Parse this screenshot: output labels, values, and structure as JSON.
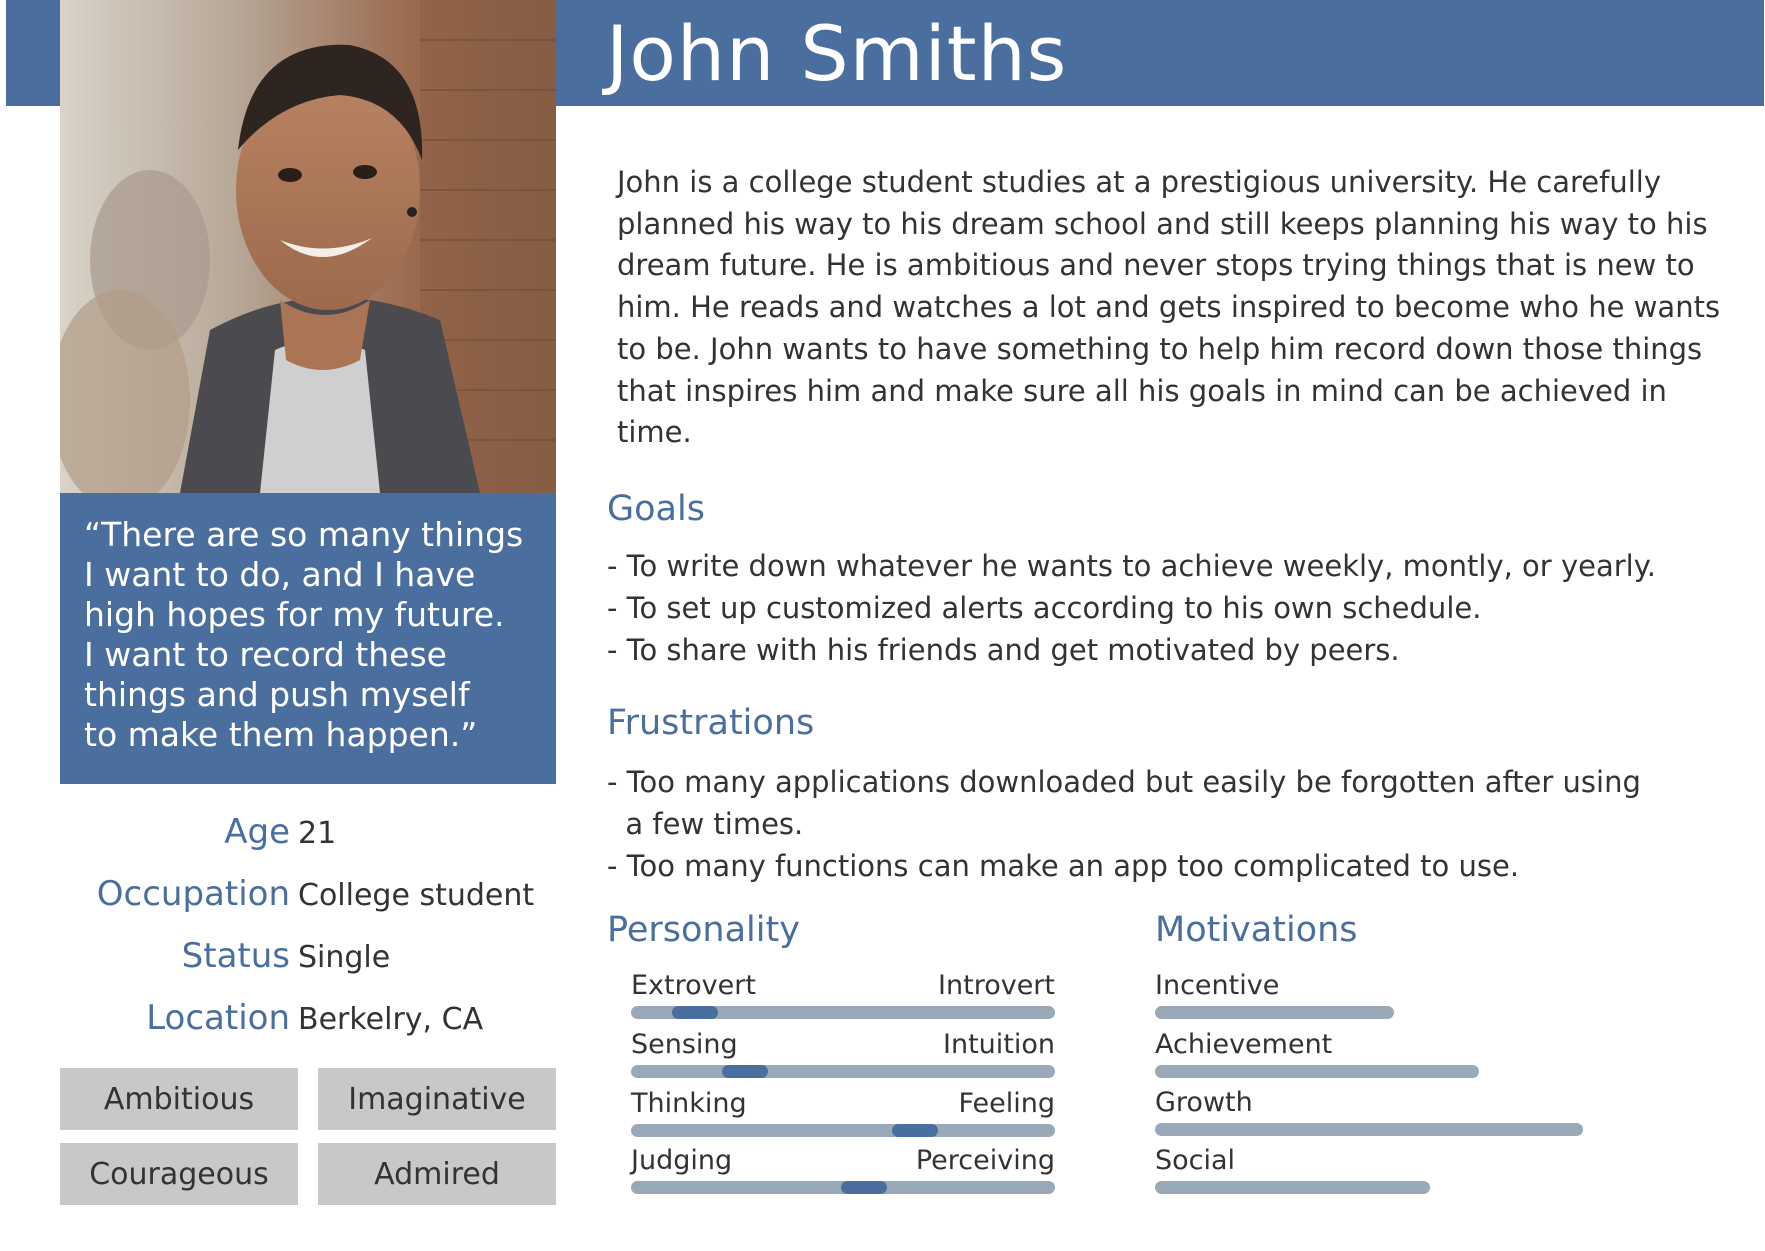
{
  "persona": {
    "name": "John Smiths",
    "quote": "“There are so many things\nI want to do, and I have\nhigh hopes for my future.\nI want to record these\nthings and push myself\nto make them happen.”",
    "info": [
      {
        "label": "Age",
        "value": "21"
      },
      {
        "label": "Occupation",
        "value": "College student"
      },
      {
        "label": "Status",
        "value": "Single"
      },
      {
        "label": "Location",
        "value": "Berkelry, CA"
      }
    ],
    "traits": [
      "Ambitious",
      "Imaginative",
      "Courageous",
      "Admired"
    ],
    "bio": "John is a college student studies at a prestigious university. He carefully planned his way to his dream school and still keeps planning his way to his dream future. He is ambitious and never stops trying things that is new to him. He reads and watches a lot and gets inspired to become who he wants to be. John wants to have something to help him record down those things that inspires him and make sure all his goals in mind can be achieved in time."
  },
  "goals": {
    "heading": "Goals",
    "items": [
      "- To write down whatever he wants to achieve weekly, montly, or yearly.",
      "- To set up customized alerts according to his own schedule.",
      "- To share with his friends and get motivated by peers."
    ]
  },
  "frustrations": {
    "heading": "Frustrations",
    "items": [
      "- Too many applications downloaded but easily be forgotten after using",
      "  a few times.",
      "- Too many functions can make an app too complicated to use."
    ]
  },
  "personality": {
    "heading": "Personality",
    "scales": [
      {
        "left": "Extrovert",
        "right": "Introvert",
        "level": 0.15
      },
      {
        "left": "Sensing",
        "right": "Intuition",
        "level": 0.27
      },
      {
        "left": "Thinking",
        "right": "Feeling",
        "level": 0.67
      },
      {
        "left": "Judging",
        "right": "Perceiving",
        "level": 0.55
      }
    ]
  },
  "motivations": {
    "heading": "Motivations",
    "items": [
      {
        "label": "Incentive",
        "level": 0.53
      },
      {
        "label": "Achievement",
        "level": 0.72
      },
      {
        "label": "Growth",
        "level": 0.95
      },
      {
        "label": "Social",
        "level": 0.61
      }
    ]
  },
  "colors": {
    "accent": "#4a6f9f",
    "bar_track": "#9aa9b7",
    "trait_bg": "#c8c8c8",
    "text": "#333333"
  }
}
